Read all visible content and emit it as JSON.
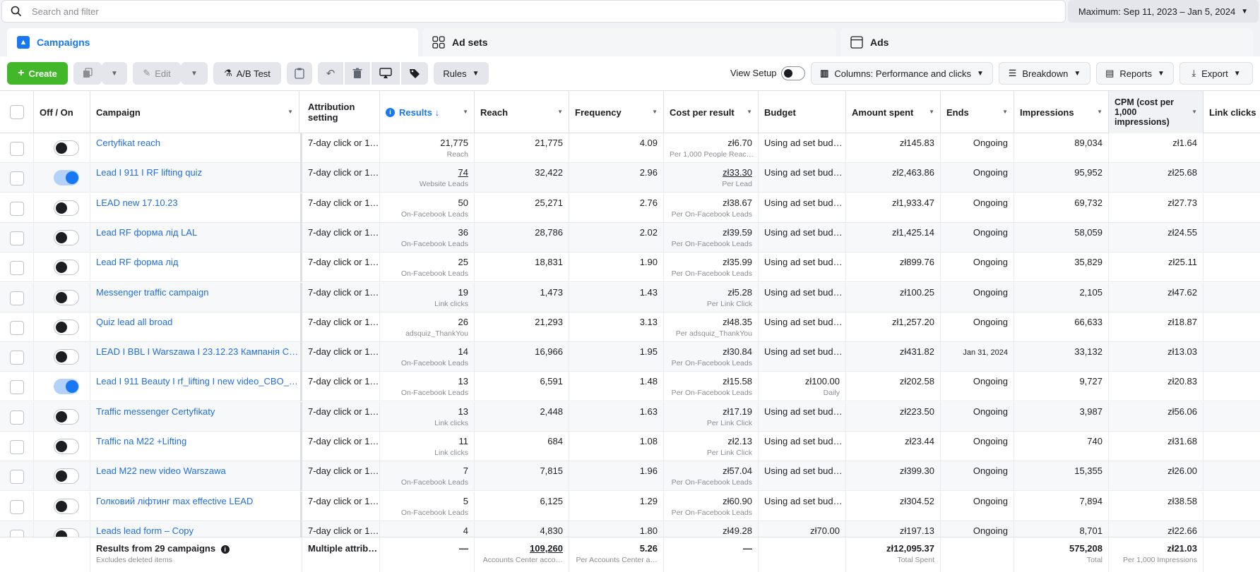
{
  "search": {
    "placeholder": "Search and filter"
  },
  "date_range": "Maximum: Sep 11, 2023 – Jan 5, 2024",
  "tabs": [
    {
      "label": "Campaigns",
      "icon": "campaign-icon"
    },
    {
      "label": "Ad sets",
      "icon": "adsets-grid-icon"
    },
    {
      "label": "Ads",
      "icon": "ads-icon"
    }
  ],
  "toolbar": {
    "create": "Create",
    "edit": "Edit",
    "ab_test": "A/B Test",
    "rules": "Rules",
    "view_setup": "View Setup",
    "columns": "Columns: Performance and clicks",
    "breakdown": "Breakdown",
    "reports": "Reports",
    "export": "Export"
  },
  "columns": [
    "Off / On",
    "Campaign",
    "Attribution setting",
    "Results ↓",
    "Reach",
    "Frequency",
    "Cost per result",
    "Budget",
    "Amount spent",
    "Ends",
    "Impressions",
    "CPM (cost per 1,000 impressions)",
    "Link clicks"
  ],
  "rows": [
    {
      "on": false,
      "campaign": "Certyfikat reach",
      "attribution": "7-day click or 1…",
      "results": "21,775",
      "results_sub": "Reach",
      "reach": "21,775",
      "frequency": "4.09",
      "cpr": "zł6.70",
      "cpr_sub": "Per 1,000 People Reac…",
      "budget": "Using ad set bud…",
      "budget_sub": "",
      "spent": "zł145.83",
      "ends": "Ongoing",
      "impressions": "89,034",
      "cpm": "zł1.64"
    },
    {
      "on": true,
      "campaign": "Lead I 911 I RF lifting quiz",
      "attribution": "7-day click or 1…",
      "results": "74",
      "results_sub": "Website Leads",
      "reach": "32,422",
      "frequency": "2.96",
      "cpr": "zł33.30",
      "cpr_sub": "Per Lead",
      "budget": "Using ad set bud…",
      "budget_sub": "",
      "spent": "zł2,463.86",
      "ends": "Ongoing",
      "impressions": "95,952",
      "cpm": "zł25.68"
    },
    {
      "on": false,
      "campaign": "LEAD new 17.10.23",
      "attribution": "7-day click or 1…",
      "results": "50",
      "results_sub": "On-Facebook Leads",
      "reach": "25,271",
      "frequency": "2.76",
      "cpr": "zł38.67",
      "cpr_sub": "Per On-Facebook Leads",
      "budget": "Using ad set bud…",
      "budget_sub": "",
      "spent": "zł1,933.47",
      "ends": "Ongoing",
      "impressions": "69,732",
      "cpm": "zł27.73"
    },
    {
      "on": false,
      "campaign": "Lead RF форма лід LAL",
      "attribution": "7-day click or 1…",
      "results": "36",
      "results_sub": "On-Facebook Leads",
      "reach": "28,786",
      "frequency": "2.02",
      "cpr": "zł39.59",
      "cpr_sub": "Per On-Facebook Leads",
      "budget": "Using ad set bud…",
      "budget_sub": "",
      "spent": "zł1,425.14",
      "ends": "Ongoing",
      "impressions": "58,059",
      "cpm": "zł24.55"
    },
    {
      "on": false,
      "campaign": "Lead RF форма лід",
      "attribution": "7-day click or 1…",
      "results": "25",
      "results_sub": "On-Facebook Leads",
      "reach": "18,831",
      "frequency": "1.90",
      "cpr": "zł35.99",
      "cpr_sub": "Per On-Facebook Leads",
      "budget": "Using ad set bud…",
      "budget_sub": "",
      "spent": "zł899.76",
      "ends": "Ongoing",
      "impressions": "35,829",
      "cpm": "zł25.11"
    },
    {
      "on": false,
      "campaign": "Messenger traffic campaign",
      "attribution": "7-day click or 1…",
      "results": "19",
      "results_sub": "Link clicks",
      "reach": "1,473",
      "frequency": "1.43",
      "cpr": "zł5.28",
      "cpr_sub": "Per Link Click",
      "budget": "Using ad set bud…",
      "budget_sub": "",
      "spent": "zł100.25",
      "ends": "Ongoing",
      "impressions": "2,105",
      "cpm": "zł47.62"
    },
    {
      "on": false,
      "campaign": "Quiz lead all broad",
      "attribution": "7-day click or 1…",
      "results": "26",
      "results_sub": "adsquiz_ThankYou",
      "reach": "21,293",
      "frequency": "3.13",
      "cpr": "zł48.35",
      "cpr_sub": "Per adsquiz_ThankYou",
      "budget": "Using ad set bud…",
      "budget_sub": "",
      "spent": "zł1,257.20",
      "ends": "Ongoing",
      "impressions": "66,633",
      "cpm": "zł18.87"
    },
    {
      "on": false,
      "campaign": "LEAD I BBL I Warszawa I 23.12.23 Кампанія C…",
      "attribution": "7-day click or 1…",
      "results": "14",
      "results_sub": "On-Facebook Leads",
      "reach": "16,966",
      "frequency": "1.95",
      "cpr": "zł30.84",
      "cpr_sub": "Per On-Facebook Leads",
      "budget": "Using ad set bud…",
      "budget_sub": "",
      "spent": "zł431.82",
      "ends": "Jan 31, 2024",
      "impressions": "33,132",
      "cpm": "zł13.03"
    },
    {
      "on": true,
      "campaign": "Lead I 911 Beauty I rf_lifting I new video_CBO_…",
      "attribution": "7-day click or 1…",
      "results": "13",
      "results_sub": "On-Facebook Leads",
      "reach": "6,591",
      "frequency": "1.48",
      "cpr": "zł15.58",
      "cpr_sub": "Per On-Facebook Leads",
      "budget": "zł100.00",
      "budget_sub": "Daily",
      "spent": "zł202.58",
      "ends": "Ongoing",
      "impressions": "9,727",
      "cpm": "zł20.83"
    },
    {
      "on": false,
      "campaign": "Traffic messenger Certyfikaty",
      "attribution": "7-day click or 1…",
      "results": "13",
      "results_sub": "Link clicks",
      "reach": "2,448",
      "frequency": "1.63",
      "cpr": "zł17.19",
      "cpr_sub": "Per Link Click",
      "budget": "Using ad set bud…",
      "budget_sub": "",
      "spent": "zł223.50",
      "ends": "Ongoing",
      "impressions": "3,987",
      "cpm": "zł56.06"
    },
    {
      "on": false,
      "campaign": "Traffic na M22 +Lifting",
      "attribution": "7-day click or 1…",
      "results": "11",
      "results_sub": "Link clicks",
      "reach": "684",
      "frequency": "1.08",
      "cpr": "zł2.13",
      "cpr_sub": "Per Link Click",
      "budget": "Using ad set bud…",
      "budget_sub": "",
      "spent": "zł23.44",
      "ends": "Ongoing",
      "impressions": "740",
      "cpm": "zł31.68"
    },
    {
      "on": false,
      "campaign": "Lead M22 new video Warszawa",
      "attribution": "7-day click or 1…",
      "results": "7",
      "results_sub": "On-Facebook Leads",
      "reach": "7,815",
      "frequency": "1.96",
      "cpr": "zł57.04",
      "cpr_sub": "Per On-Facebook Leads",
      "budget": "Using ad set bud…",
      "budget_sub": "",
      "spent": "zł399.30",
      "ends": "Ongoing",
      "impressions": "15,355",
      "cpm": "zł26.00"
    },
    {
      "on": false,
      "campaign": "Голковий ліфтинг max effective LEAD",
      "attribution": "7-day click or 1…",
      "results": "5",
      "results_sub": "On-Facebook Leads",
      "reach": "6,125",
      "frequency": "1.29",
      "cpr": "zł60.90",
      "cpr_sub": "Per On-Facebook Leads",
      "budget": "Using ad set bud…",
      "budget_sub": "",
      "spent": "zł304.52",
      "ends": "Ongoing",
      "impressions": "7,894",
      "cpm": "zł38.58"
    },
    {
      "on": false,
      "campaign": "Leads lead form – Copy",
      "attribution": "7-day click or 1…",
      "results": "4",
      "results_sub": "",
      "reach": "4,830",
      "frequency": "1.80",
      "cpr": "zł49.28",
      "cpr_sub": "",
      "budget": "zł70.00",
      "budget_sub": "",
      "spent": "zł197.13",
      "ends": "Ongoing",
      "impressions": "8,701",
      "cpm": "zł22.66"
    }
  ],
  "footer": {
    "title": "Results from 29 campaigns",
    "title_sub": "Excludes deleted items",
    "attribution": "Multiple attrib…",
    "results": "—",
    "reach": "109,260",
    "reach_sub": "Accounts Center acco…",
    "frequency": "5.26",
    "frequency_sub": "Per Accounts Center a…",
    "cpr": "—",
    "spent": "zł12,095.37",
    "spent_sub": "Total Spent",
    "impressions": "575,208",
    "impressions_sub": "Total",
    "cpm": "zł21.03",
    "cpm_sub": "Per 1,000 Impressions"
  },
  "colors": {
    "accent": "#1877f2",
    "create": "#42b72a",
    "link": "#216fdb"
  }
}
